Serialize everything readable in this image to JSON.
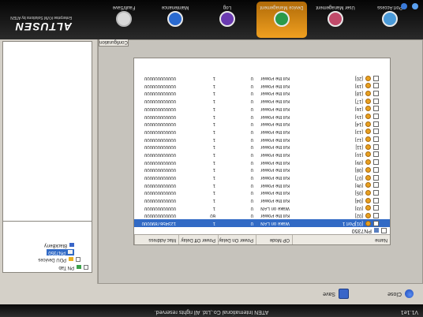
{
  "window": {
    "version": "V1.1e1",
    "copyright": "ATEN International Co.,Ltd. All rights reserved."
  },
  "toolbar": {
    "close_label": "Close",
    "save_label": "Save"
  },
  "grid": {
    "headers": [
      "Name",
      "OP Mode",
      "Power On Delay",
      "Power Off Delay",
      "Mac Address"
    ],
    "root_label": "PN7350",
    "rows": [
      {
        "name": "[01]Port 1",
        "mode": "Wake on LAN",
        "on": "0",
        "off": "1",
        "mac": "1234567890000",
        "selected": true
      },
      {
        "name": "[02]",
        "mode": "Kill the Power",
        "on": "0",
        "off": "60",
        "mac": "000000000000",
        "selected": false
      },
      {
        "name": "[03]",
        "mode": "Wake on LAN",
        "on": "0",
        "off": "1",
        "mac": "000000000000",
        "selected": false
      },
      {
        "name": "[04]",
        "mode": "Kill the Power",
        "on": "0",
        "off": "1",
        "mac": "000000000000",
        "selected": false
      },
      {
        "name": "[05]",
        "mode": "Kill the Power",
        "on": "0",
        "off": "1",
        "mac": "000000000000",
        "selected": false
      },
      {
        "name": "[06]",
        "mode": "Kill the Power",
        "on": "0",
        "off": "1",
        "mac": "000000000000",
        "selected": false
      },
      {
        "name": "[07]",
        "mode": "Kill the Power",
        "on": "0",
        "off": "1",
        "mac": "000000000000",
        "selected": false
      },
      {
        "name": "[08]",
        "mode": "Kill the Power",
        "on": "0",
        "off": "1",
        "mac": "000000000000",
        "selected": false
      },
      {
        "name": "[09]",
        "mode": "Kill the Power",
        "on": "0",
        "off": "1",
        "mac": "000000000000",
        "selected": false
      },
      {
        "name": "[10]",
        "mode": "Kill the Power",
        "on": "0",
        "off": "1",
        "mac": "000000000000",
        "selected": false
      },
      {
        "name": "[11]",
        "mode": "Kill the Power",
        "on": "0",
        "off": "1",
        "mac": "000000000000",
        "selected": false
      },
      {
        "name": "[12]",
        "mode": "Kill the Power",
        "on": "0",
        "off": "1",
        "mac": "000000000000",
        "selected": false
      },
      {
        "name": "[13]",
        "mode": "Kill the Power",
        "on": "0",
        "off": "1",
        "mac": "000000000000",
        "selected": false
      },
      {
        "name": "[14]",
        "mode": "Kill the Power",
        "on": "0",
        "off": "1",
        "mac": "000000000000",
        "selected": false
      },
      {
        "name": "[15]",
        "mode": "Kill the Power",
        "on": "0",
        "off": "1",
        "mac": "000000000000",
        "selected": false
      },
      {
        "name": "[16]",
        "mode": "Kill the Power",
        "on": "0",
        "off": "1",
        "mac": "000000000000",
        "selected": false
      },
      {
        "name": "[17]",
        "mode": "Kill the Power",
        "on": "0",
        "off": "1",
        "mac": "000000000000",
        "selected": false
      },
      {
        "name": "[18]",
        "mode": "Kill the Power",
        "on": "0",
        "off": "1",
        "mac": "000000000000",
        "selected": false
      },
      {
        "name": "[19]",
        "mode": "Kill the Power",
        "on": "0",
        "off": "1",
        "mac": "000000000000",
        "selected": false
      },
      {
        "name": "[20]",
        "mode": "Kill the Power",
        "on": "0",
        "off": "1",
        "mac": "000000000000",
        "selected": false
      }
    ]
  },
  "tab": {
    "configuration": "Configuration"
  },
  "tree": {
    "root": "PN Tab",
    "poe": "PDU Devices",
    "pn7350": "PN7350",
    "blackberry": "BlackBerry"
  },
  "logo": {
    "brand": "ALTUSEN",
    "slogan": "Enterprise KVM Solutions by ATEN"
  },
  "nav": {
    "fault_save": "Fault/Save",
    "maintenance": "Maintenance",
    "log": "Log",
    "device_mgmt": "Device Management",
    "user_mgmt": "User Management",
    "port_access": "Port Access"
  },
  "icons": {
    "close": "close-icon",
    "save": "save-icon",
    "plug": "plug-icon",
    "sound": "sound-icon",
    "help": "help-icon"
  },
  "colors": {
    "selection": "#316ac5",
    "active_nav": "#f0a020"
  }
}
